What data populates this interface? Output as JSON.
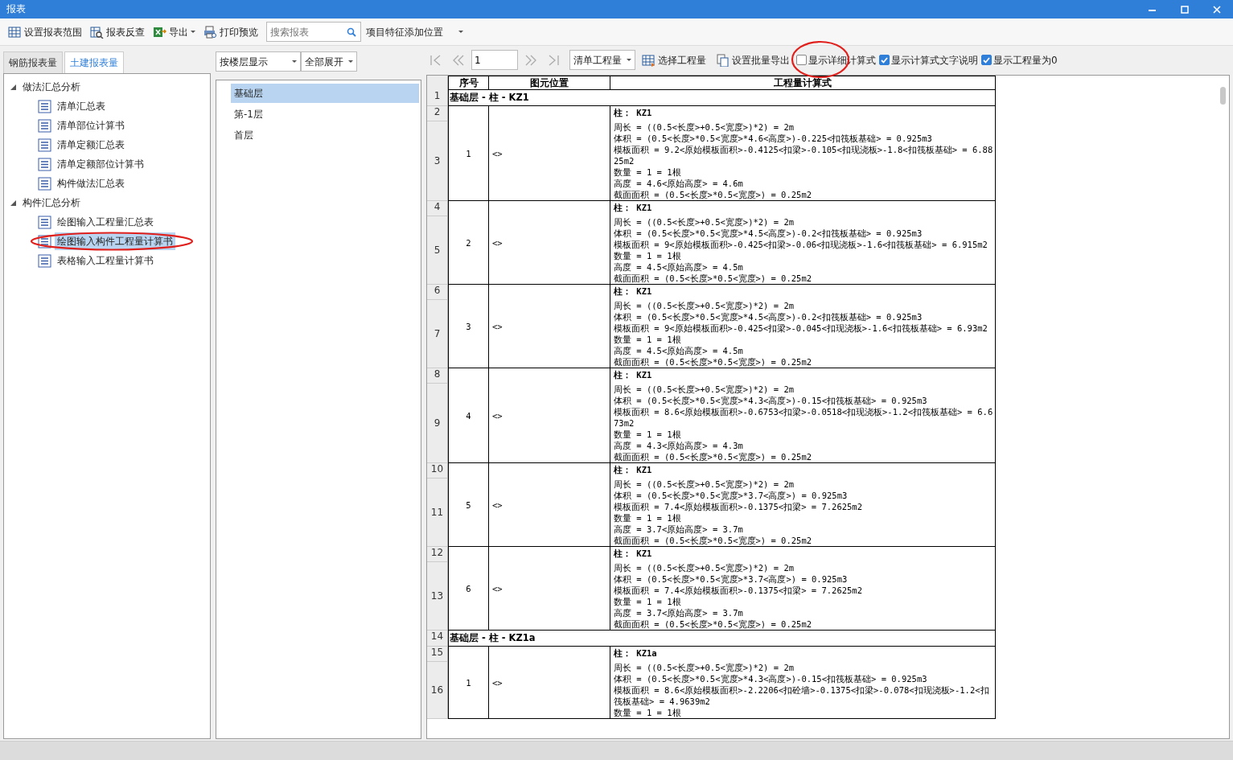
{
  "window": {
    "title": "报表"
  },
  "toolbar": [
    {
      "kind": "button",
      "label": "设置报表范围"
    },
    {
      "kind": "button",
      "label": "报表反查"
    },
    {
      "kind": "menu",
      "label": "导出"
    },
    {
      "kind": "button",
      "label": "打印预览"
    },
    {
      "kind": "search",
      "placeholder": "搜索报表"
    },
    {
      "kind": "dropdown",
      "label": "项目特征添加位置"
    }
  ],
  "left_tabs": [
    {
      "label": "钢筋报表量",
      "selected": false
    },
    {
      "label": "土建报表量",
      "selected": true
    }
  ],
  "tree": [
    {
      "label": "做法汇总分析",
      "expanded": true,
      "children": [
        {
          "label": "清单汇总表",
          "selected": false,
          "circled": false
        },
        {
          "label": "清单部位计算书",
          "selected": false,
          "circled": false
        },
        {
          "label": "清单定额汇总表",
          "selected": false,
          "circled": false
        },
        {
          "label": "清单定额部位计算书",
          "selected": false,
          "circled": false
        },
        {
          "label": "构件做法汇总表",
          "selected": false,
          "circled": false
        }
      ]
    },
    {
      "label": "构件汇总分析",
      "expanded": true,
      "children": [
        {
          "label": "绘图输入工程量汇总表",
          "selected": false,
          "circled": false
        },
        {
          "label": "绘图输入构件工程量计算书",
          "selected": true,
          "circled": true
        },
        {
          "label": "表格输入工程量计算书",
          "selected": false,
          "circled": false
        }
      ]
    }
  ],
  "floor_panel": {
    "mode": "按楼层显示",
    "expand": "全部展开",
    "floors": [
      {
        "label": "基础层",
        "selected": true
      },
      {
        "label": "第-1层",
        "selected": false
      },
      {
        "label": "首层",
        "selected": false
      }
    ]
  },
  "report_toolbar": {
    "page": "1",
    "quantity_type": "清单工程量",
    "buttons": [
      "选择工程量",
      "设置批量导出"
    ],
    "options": [
      {
        "label": "显示详细计算式",
        "checked": false,
        "circled": true
      },
      {
        "label": "显示计算式文字说明",
        "checked": true,
        "circled": false
      },
      {
        "label": "显示工程量为0",
        "checked": true,
        "circled": false
      }
    ]
  },
  "report": {
    "columns": [
      "序号",
      "图元位置",
      "工程量计算式"
    ],
    "entries": [
      {
        "kind": "group",
        "nums": [
          "1"
        ],
        "text": "基础层 - 柱 - KZ1"
      },
      {
        "kind": "item",
        "nums": [
          "2",
          "3"
        ],
        "seq": "1",
        "position": "<>",
        "title": "柱： KZ1",
        "lines": [
          "周长 = ((0.5<长度>+0.5<宽度>)*2) = 2m",
          "体积 = (0.5<长度>*0.5<宽度>*4.6<高度>)-0.225<扣筏板基础> = 0.925m3",
          "模板面积 = 9.2<原始模板面积>-0.4125<扣梁>-0.105<扣现浇板>-1.8<扣筏板基础> = 6.8825m2",
          "数量 = 1 = 1根",
          "高度 = 4.6<原始高度> = 4.6m",
          "截面面积 = (0.5<长度>*0.5<宽度>) = 0.25m2"
        ]
      },
      {
        "kind": "item",
        "nums": [
          "4",
          "5"
        ],
        "seq": "2",
        "position": "<>",
        "title": "柱： KZ1",
        "lines": [
          "周长 = ((0.5<长度>+0.5<宽度>)*2) = 2m",
          "体积 = (0.5<长度>*0.5<宽度>*4.5<高度>)-0.2<扣筏板基础> = 0.925m3",
          "模板面积 = 9<原始模板面积>-0.425<扣梁>-0.06<扣现浇板>-1.6<扣筏板基础> = 6.915m2",
          "数量 = 1 = 1根",
          "高度 = 4.5<原始高度> = 4.5m",
          "截面面积 = (0.5<长度>*0.5<宽度>) = 0.25m2"
        ]
      },
      {
        "kind": "item",
        "nums": [
          "6",
          "7"
        ],
        "seq": "3",
        "position": "<>",
        "title": "柱： KZ1",
        "lines": [
          "周长 = ((0.5<长度>+0.5<宽度>)*2) = 2m",
          "体积 = (0.5<长度>*0.5<宽度>*4.5<高度>)-0.2<扣筏板基础> = 0.925m3",
          "模板面积 = 9<原始模板面积>-0.425<扣梁>-0.045<扣现浇板>-1.6<扣筏板基础> = 6.93m2",
          "数量 = 1 = 1根",
          "高度 = 4.5<原始高度> = 4.5m",
          "截面面积 = (0.5<长度>*0.5<宽度>) = 0.25m2"
        ]
      },
      {
        "kind": "item",
        "nums": [
          "8",
          "9"
        ],
        "seq": "4",
        "position": "<>",
        "title": "柱： KZ1",
        "lines": [
          "周长 = ((0.5<长度>+0.5<宽度>)*2) = 2m",
          "体积 = (0.5<长度>*0.5<宽度>*4.3<高度>)-0.15<扣筏板基础> = 0.925m3",
          "模板面积 = 8.6<原始模板面积>-0.6753<扣梁>-0.0518<扣现浇板>-1.2<扣筏板基础> = 6.673m2",
          "数量 = 1 = 1根",
          "高度 = 4.3<原始高度> = 4.3m",
          "截面面积 = (0.5<长度>*0.5<宽度>) = 0.25m2"
        ]
      },
      {
        "kind": "item",
        "nums": [
          "10",
          "11"
        ],
        "seq": "5",
        "position": "<>",
        "title": "柱： KZ1",
        "lines": [
          "周长 = ((0.5<长度>+0.5<宽度>)*2) = 2m",
          "体积 = (0.5<长度>*0.5<宽度>*3.7<高度>) = 0.925m3",
          "模板面积 = 7.4<原始模板面积>-0.1375<扣梁> = 7.2625m2",
          "数量 = 1 = 1根",
          "高度 = 3.7<原始高度> = 3.7m",
          "截面面积 = (0.5<长度>*0.5<宽度>) = 0.25m2"
        ]
      },
      {
        "kind": "item",
        "nums": [
          "12",
          "13"
        ],
        "seq": "6",
        "position": "<>",
        "title": "柱： KZ1",
        "lines": [
          "周长 = ((0.5<长度>+0.5<宽度>)*2) = 2m",
          "体积 = (0.5<长度>*0.5<宽度>*3.7<高度>) = 0.925m3",
          "模板面积 = 7.4<原始模板面积>-0.1375<扣梁> = 7.2625m2",
          "数量 = 1 = 1根",
          "高度 = 3.7<原始高度> = 3.7m",
          "截面面积 = (0.5<长度>*0.5<宽度>) = 0.25m2"
        ]
      },
      {
        "kind": "group",
        "nums": [
          "14"
        ],
        "text": "基础层 - 柱 - KZ1a"
      },
      {
        "kind": "item",
        "nums": [
          "15",
          "16"
        ],
        "seq": "1",
        "position": "<>",
        "title": "柱： KZ1a",
        "lines": [
          "周长 = ((0.5<长度>+0.5<宽度>)*2) = 2m",
          "体积 = (0.5<长度>*0.5<宽度>*4.3<高度>)-0.15<扣筏板基础> = 0.925m3",
          "模板面积 = 8.6<原始模板面积>-2.2206<扣砼墙>-0.1375<扣梁>-0.078<扣现浇板>-1.2<扣筏板基础> = 4.9639m2",
          "数量 = 1 = 1根"
        ]
      }
    ]
  }
}
